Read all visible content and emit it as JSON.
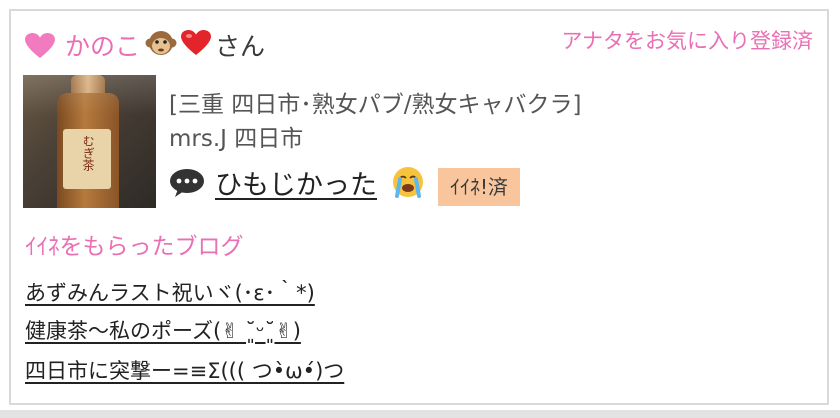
{
  "header": {
    "name": "かのこ",
    "honorific": "さん",
    "favorite_link": "アナタをお気に入り登録済"
  },
  "shop": {
    "category": "[三重 四日市･熟女パブ/熟女キャバクラ]",
    "name": "mrs.J 四日市"
  },
  "post": {
    "title": "ひもじかった",
    "like_badge": "ｲｲﾈ!済",
    "thumbnail_label": "むぎ茶"
  },
  "liked_blogs": {
    "heading": "ｲｲﾈをもらったブログ",
    "items": [
      "あずみんラスト祝いヾ(･ε･｀*)",
      "健康茶〜私のポーズ(✌︎ ˘͈ᵕ˘͈✌︎)",
      "四日市に突撃ー=≡Σ((( つ•̀ω•́)つ"
    ]
  },
  "colors": {
    "accent_pink": "#ea6fb4",
    "badge_bg": "#f9c59c",
    "border": "#d9d9d9"
  },
  "icons": [
    "heart-icon",
    "monkey-icon",
    "red-heart-icon",
    "comment-icon",
    "crying-face-icon"
  ]
}
